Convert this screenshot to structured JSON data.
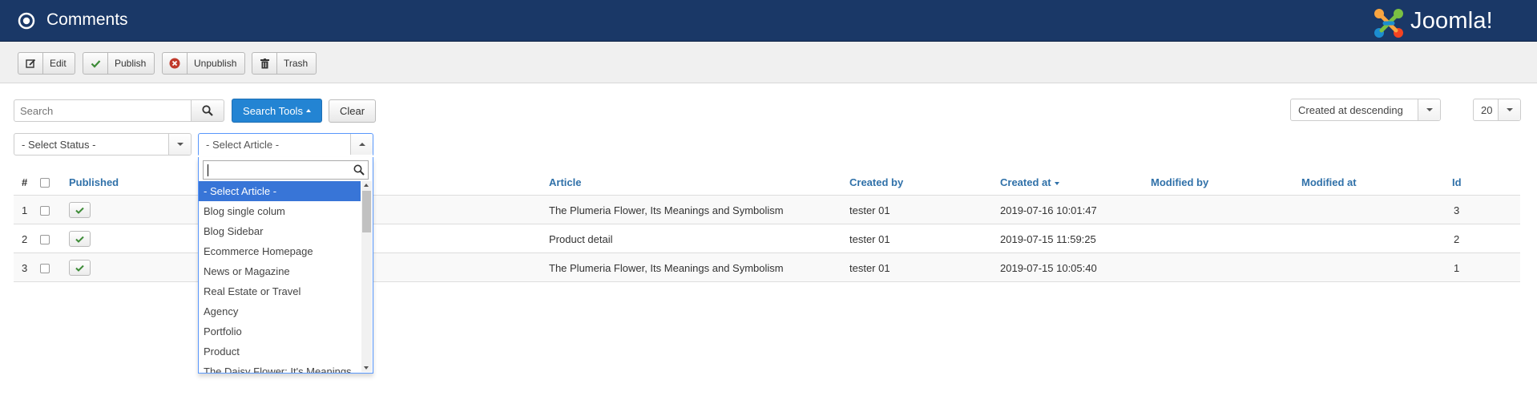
{
  "header": {
    "title": "Comments",
    "logo_text": "Joomla!"
  },
  "toolbar": {
    "edit": "Edit",
    "publish": "Publish",
    "unpublish": "Unpublish",
    "trash": "Trash"
  },
  "filters": {
    "search_placeholder": "Search",
    "search_tools": "Search Tools",
    "clear": "Clear",
    "sort": "Created at descending",
    "limit": "20",
    "status": "- Select Status -",
    "article": "- Select Article -"
  },
  "table": {
    "headers": {
      "num": "#",
      "published": "Published",
      "article": "Article",
      "created_by": "Created by",
      "created_at": "Created at",
      "modified_by": "Modified by",
      "modified_at": "Modified at",
      "id": "Id"
    },
    "rows": [
      {
        "num": "1",
        "article": "The Plumeria Flower, Its Meanings and Symbolism",
        "created_by": "tester 01",
        "created_at": "2019-07-16 10:01:47",
        "modified_by": "",
        "modified_at": "",
        "id": "3"
      },
      {
        "num": "2",
        "article": "Product detail",
        "created_by": "tester 01",
        "created_at": "2019-07-15 11:59:25",
        "modified_by": "",
        "modified_at": "",
        "id": "2"
      },
      {
        "num": "3",
        "article": "The Plumeria Flower, Its Meanings and Symbolism",
        "created_by": "tester 01",
        "created_at": "2019-07-15 10:05:40",
        "modified_by": "",
        "modified_at": "",
        "id": "1"
      }
    ]
  },
  "article_dropdown": {
    "search_value": "",
    "options": [
      "- Select Article -",
      "Blog single colum",
      "Blog Sidebar",
      "Ecommerce Homepage",
      "News or Magazine",
      "Real Estate or Travel",
      "Agency",
      "Portfolio",
      "Product",
      "The Daisy Flower: It's Meanings"
    ]
  },
  "colors": {
    "header_bg": "#1a3867",
    "primary": "#2384d3",
    "link": "#3071a9",
    "publish_green": "#3d8b37",
    "unpublish_red": "#c0392b"
  }
}
